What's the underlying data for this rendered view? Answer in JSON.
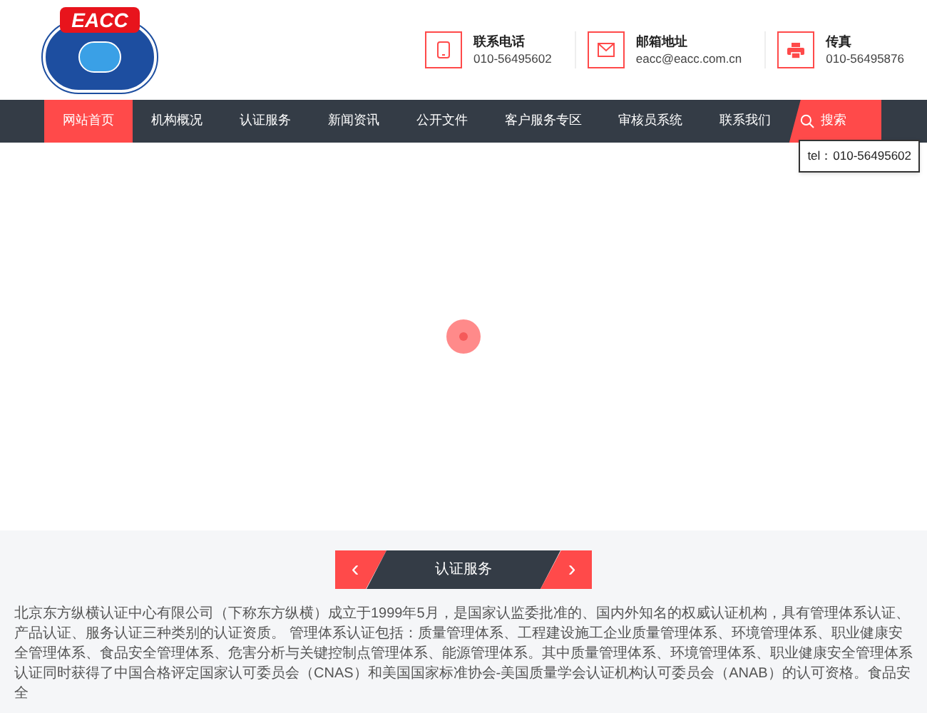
{
  "logo": {
    "text": "EACC"
  },
  "contacts": [
    {
      "kind": "phone",
      "label": "联系电话",
      "value": "010-56495602"
    },
    {
      "kind": "mail",
      "label": "邮箱地址",
      "value": "eacc@eacc.com.cn"
    },
    {
      "kind": "fax",
      "label": "传真",
      "value": "010-56495876"
    }
  ],
  "nav": {
    "items": [
      {
        "label": "网站首页",
        "selected": true
      },
      {
        "label": "机构概况",
        "selected": false
      },
      {
        "label": "认证服务",
        "selected": false
      },
      {
        "label": "新闻资讯",
        "selected": false
      },
      {
        "label": "公开文件",
        "selected": false
      },
      {
        "label": "客户服务专区",
        "selected": false
      },
      {
        "label": "审核员系统",
        "selected": false
      },
      {
        "label": "联系我们",
        "selected": false
      }
    ],
    "search": "搜索",
    "tooltip": "tel：010-56495602"
  },
  "section": {
    "prev": "‹",
    "title": "认证服务",
    "next": "›",
    "text": "北京东方纵横认证中心有限公司（下称东方纵横）成立于1999年5月，是国家认监委批准的、国内外知名的权威认证机构，具有管理体系认证、产品认证、服务认证三种类别的认证资质。 管理体系认证包括：质量管理体系、工程建设施工企业质量管理体系、环境管理体系、职业健康安全管理体系、食品安全管理体系、危害分析与关键控制点管理体系、能源管理体系。其中质量管理体系、环境管理体系、职业健康安全管理体系认证同时获得了中国合格评定国家认可委员会（CNAS）和美国国家标准协会-美国质量学会认证机构认可委员会（ANAB）的认可资格。食品安全"
  }
}
